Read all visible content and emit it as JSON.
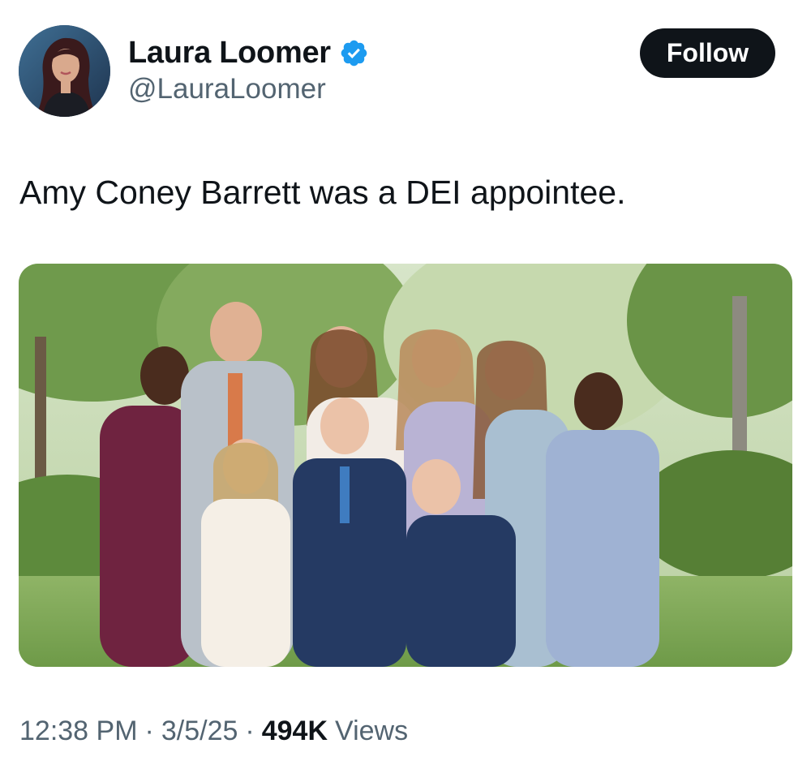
{
  "author": {
    "name": "Laura Loomer",
    "handle": "@LauraLoomer",
    "verified": true,
    "avatar_icon": "profile-photo"
  },
  "follow_button": {
    "label": "Follow"
  },
  "tweet": {
    "text": "Amy Coney Barrett was a DEI appointee.",
    "media": {
      "type": "photo",
      "icon": "family-photo"
    }
  },
  "meta": {
    "time": "12:38 PM",
    "separator": "·",
    "date": "3/5/25",
    "views_count": "494K",
    "views_label": "Views"
  },
  "colors": {
    "text_primary": "#0f1419",
    "text_secondary": "#536471",
    "verified_blue": "#1d9bf0",
    "button_bg": "#0f1419",
    "button_text": "#ffffff"
  }
}
